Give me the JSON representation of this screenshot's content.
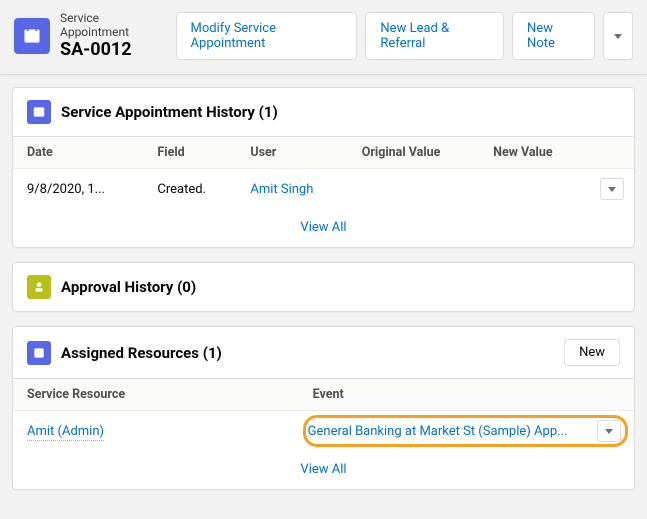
{
  "header": {
    "object_label": "Service Appointment",
    "record_name": "SA-0012",
    "actions": {
      "modify": "Modify Service Appointment",
      "new_lead": "New Lead & Referral",
      "new_note": "New Note"
    }
  },
  "history_card": {
    "title": "Service Appointment History (1)",
    "columns": {
      "date": "Date",
      "field": "Field",
      "user": "User",
      "orig": "Original Value",
      "newv": "New Value"
    },
    "row": {
      "date": "9/8/2020, 1...",
      "field": "Created.",
      "user": "Amit Singh",
      "orig": "",
      "newv": ""
    },
    "view_all": "View All"
  },
  "approval_card": {
    "title": "Approval History (0)"
  },
  "assigned_card": {
    "title": "Assigned Resources (1)",
    "new_label": "New",
    "columns": {
      "resource": "Service Resource",
      "event": "Event"
    },
    "row": {
      "resource": "Amit (Admin)",
      "event": "General Banking at Market St (Sample) App..."
    },
    "view_all": "View All"
  }
}
